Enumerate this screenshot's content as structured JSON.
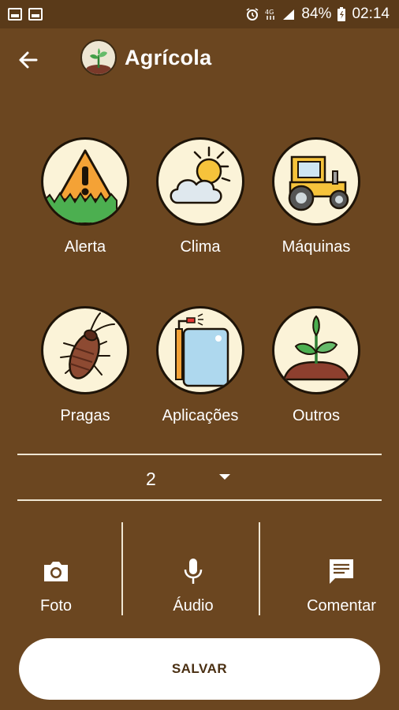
{
  "status_bar": {
    "battery": "84%",
    "time": "02:14",
    "icons": [
      "image-icon",
      "wifi-card-icon",
      "alarm-icon",
      "signal-4g-icon",
      "signal-bars-icon",
      "battery-charging-icon"
    ]
  },
  "header": {
    "back_icon": "arrow-left-icon",
    "logo_icon": "sprout-logo-icon",
    "title": "Agrícola"
  },
  "categories": [
    {
      "label": "Alerta",
      "icon": "warning-sign-icon"
    },
    {
      "label": "Clima",
      "icon": "sun-cloud-icon"
    },
    {
      "label": "Máquinas",
      "icon": "tractor-icon"
    },
    {
      "label": "Pragas",
      "icon": "cockroach-icon"
    },
    {
      "label": "Aplicações",
      "icon": "sprayer-icon"
    },
    {
      "label": "Outros",
      "icon": "plant-icon"
    }
  ],
  "selector": {
    "value": "2",
    "icon": "dropdown-arrow-icon"
  },
  "actions": [
    {
      "label": "Foto",
      "icon": "camera-icon"
    },
    {
      "label": "Áudio",
      "icon": "microphone-icon"
    },
    {
      "label": "Comentar",
      "icon": "comment-icon"
    }
  ],
  "save_button": {
    "label": "SALVAR"
  },
  "colors": {
    "background": "#6b4620",
    "status_bar": "#5a3a19",
    "circle": "#fbf3d8",
    "button": "#ffffff"
  }
}
